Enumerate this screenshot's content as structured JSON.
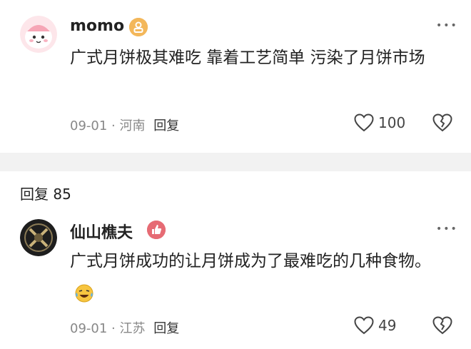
{
  "comments": [
    {
      "username": "momo",
      "text": "广式月饼极其难吃 靠着工艺简单 污染了月饼市场",
      "date": "09-01",
      "location": "河南",
      "reply_label": "回复",
      "likes": "100",
      "colors": {
        "badge": "#f3b75a"
      },
      "avatar_icon": "pink-cartoon-avatar"
    },
    {
      "username": "仙山樵夫",
      "text": "广式月饼成功的让月饼成为了最难吃的几种食物。",
      "date": "09-01",
      "location": "江苏",
      "reply_label": "回复",
      "likes": "49",
      "emoji": "laughing-crying-emoji",
      "colors": {
        "badge": "#e66b74"
      },
      "avatar_icon": "dark-emblem-avatar"
    }
  ],
  "replies_header": "回复 85",
  "meta_separator": "·"
}
